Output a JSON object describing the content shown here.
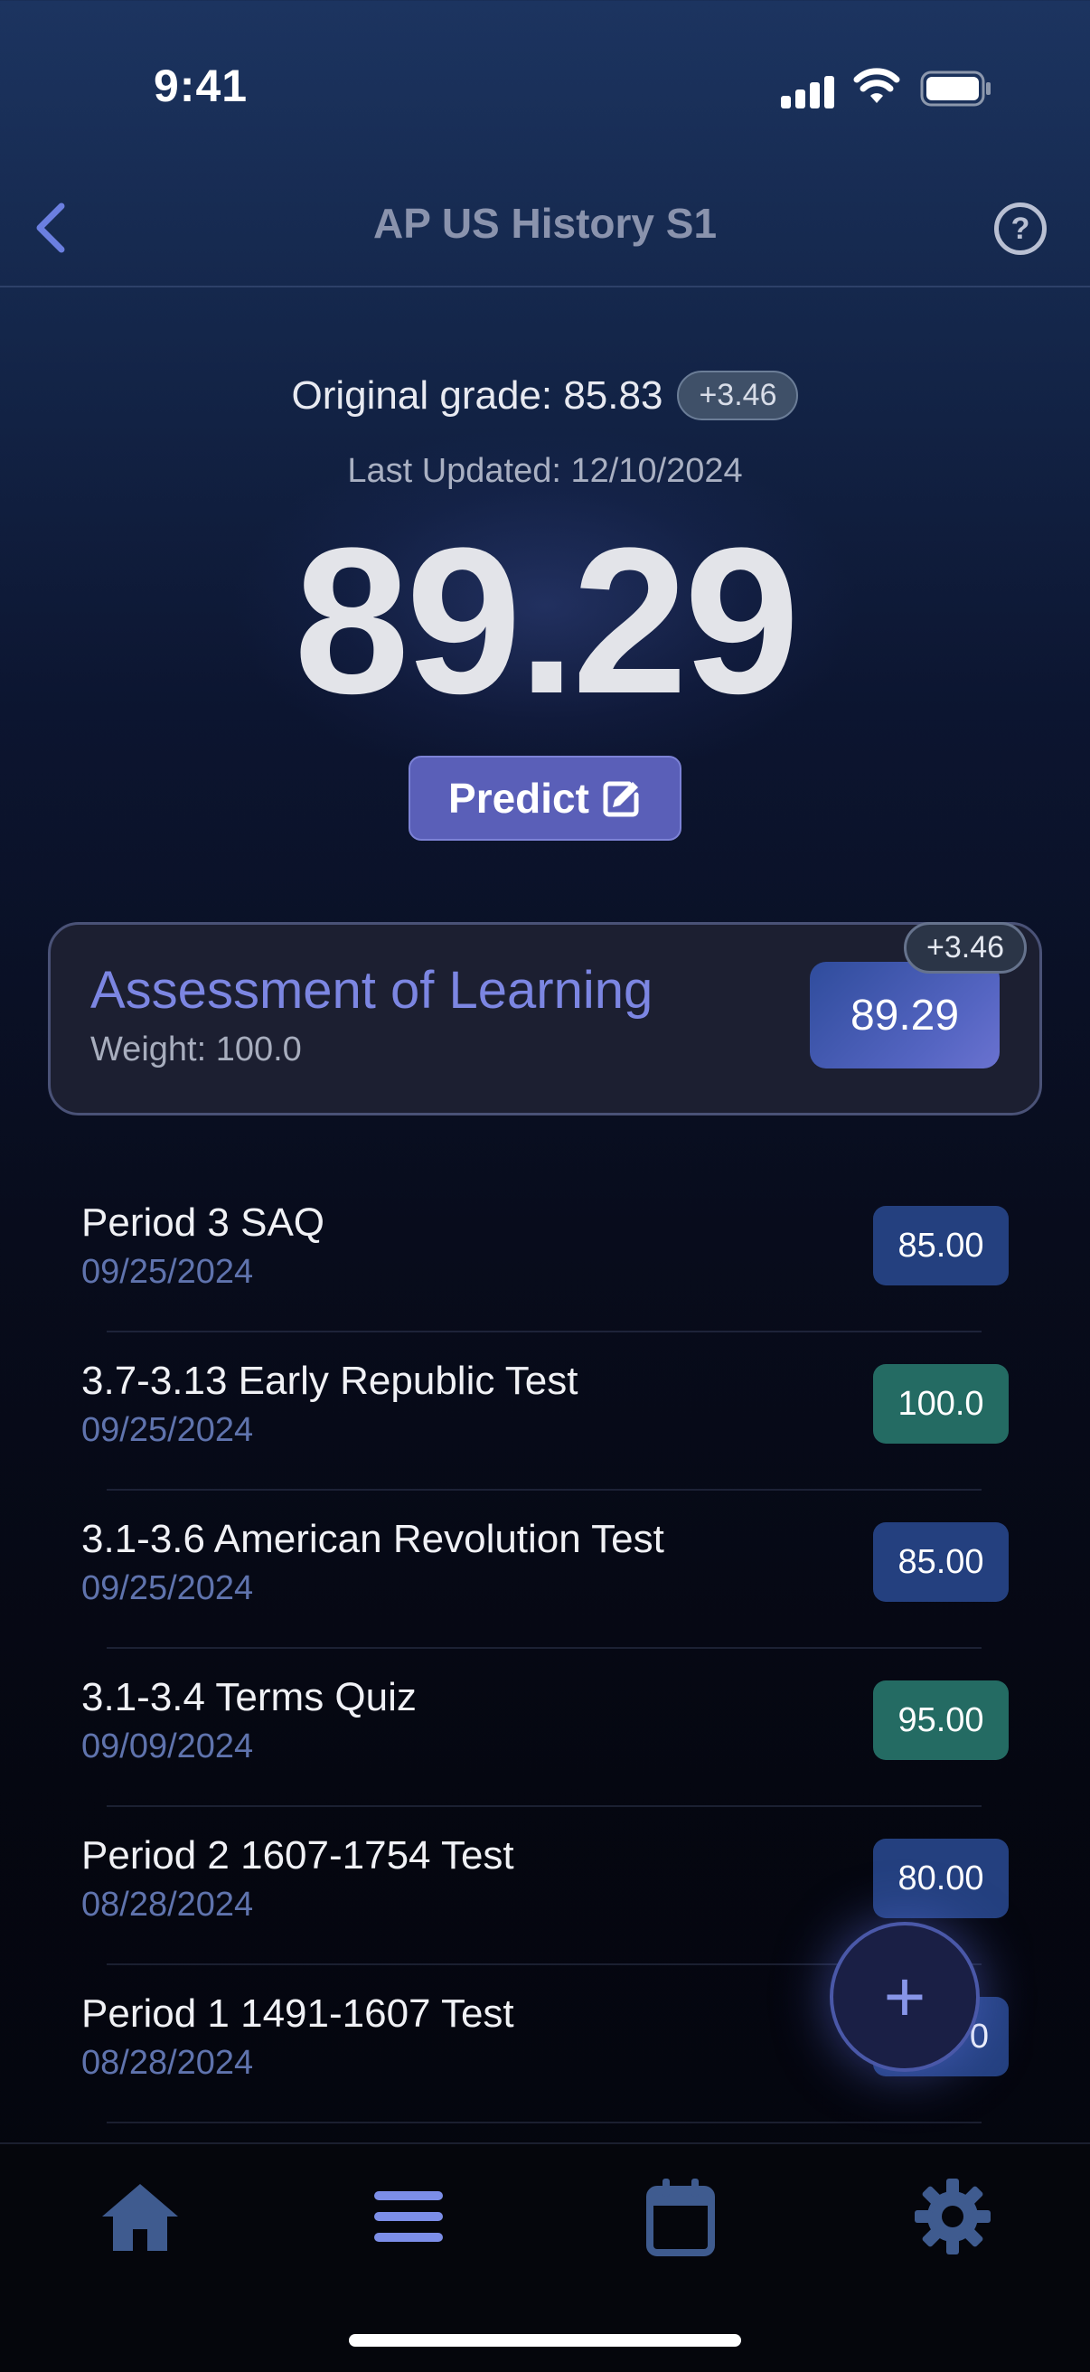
{
  "status_bar": {
    "time": "9:41"
  },
  "nav": {
    "title": "AP US History S1",
    "help_symbol": "?"
  },
  "summary": {
    "original_label": "Original grade: 85.83",
    "delta": "+3.46",
    "last_updated": "Last Updated: 12/10/2024",
    "current_grade": "89.29",
    "predict_label": "Predict"
  },
  "category": {
    "name": "Assessment of Learning",
    "weight": "Weight: 100.0",
    "grade": "89.29",
    "delta": "+3.46"
  },
  "assignments": [
    {
      "name": "Period 3 SAQ",
      "date": "09/25/2024",
      "score": "85.00",
      "color": "#24407f"
    },
    {
      "name": "3.7-3.13 Early Republic Test",
      "date": "09/25/2024",
      "score": "100.0",
      "color": "#246b63"
    },
    {
      "name": "3.1-3.6 American Revolution Test",
      "date": "09/25/2024",
      "score": "85.00",
      "color": "#24407f"
    },
    {
      "name": "3.1-3.4 Terms Quiz",
      "date": "09/09/2024",
      "score": "95.00",
      "color": "#246b63"
    },
    {
      "name": "Period 2 1607-1754 Test",
      "date": "08/28/2024",
      "score": "80.00",
      "color": "#24407f"
    },
    {
      "name": "Period 1 1491-1607 Test",
      "date": "08/28/2024",
      "score": "0",
      "color": "#24407f"
    }
  ],
  "fab": {
    "symbol": "+"
  },
  "tabs": [
    {
      "icon": "home-icon"
    },
    {
      "icon": "list-icon"
    },
    {
      "icon": "calendar-icon"
    },
    {
      "icon": "gear-icon"
    }
  ],
  "colors": {
    "accent": "#7c86e2",
    "predict": "#5a5fb8",
    "score_blue": "#24407f",
    "score_green": "#246b63"
  }
}
